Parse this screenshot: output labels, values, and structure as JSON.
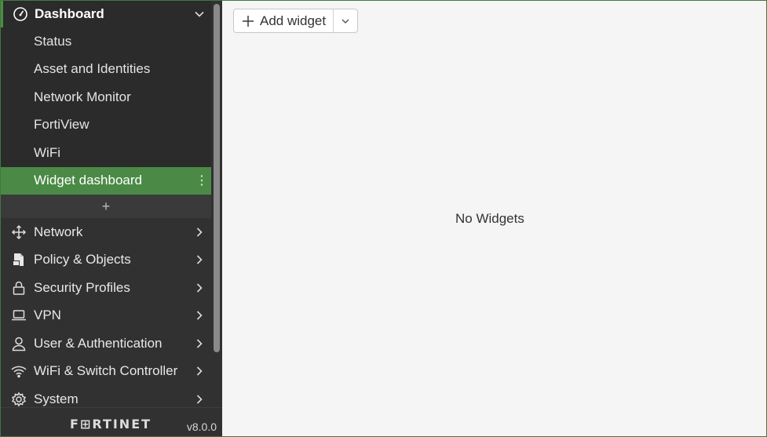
{
  "sidebar": {
    "dashboard": {
      "label": "Dashboard",
      "icon": "speedometer-icon",
      "items": [
        {
          "label": "Status"
        },
        {
          "label": "Asset and Identities"
        },
        {
          "label": "Network Monitor"
        },
        {
          "label": "FortiView"
        },
        {
          "label": "WiFi"
        },
        {
          "label": "Widget dashboard",
          "active": true
        }
      ],
      "add_label": "+"
    },
    "sections": [
      {
        "label": "Network",
        "icon": "move-arrows-icon"
      },
      {
        "label": "Policy & Objects",
        "icon": "document-icon"
      },
      {
        "label": "Security Profiles",
        "icon": "lock-icon"
      },
      {
        "label": "VPN",
        "icon": "laptop-icon"
      },
      {
        "label": "User & Authentication",
        "icon": "user-icon"
      },
      {
        "label": "WiFi & Switch Controller",
        "icon": "wifi-icon"
      },
      {
        "label": "System",
        "icon": "gear-icon"
      }
    ],
    "footer": {
      "logo": "F⊞RTINET",
      "version": "v8.0.0"
    }
  },
  "main": {
    "add_widget_label": "Add widget",
    "empty_message": "No Widgets"
  },
  "colors": {
    "sidebar_bg": "#313131",
    "active_bg": "#4b8a46",
    "main_bg": "#f5f5f5"
  }
}
